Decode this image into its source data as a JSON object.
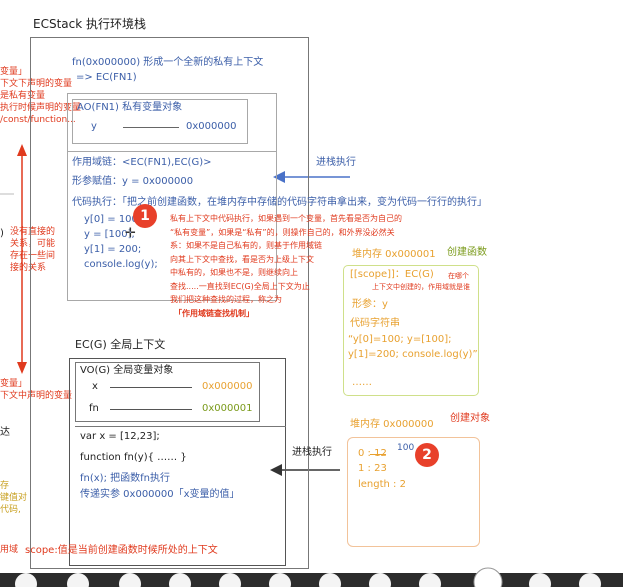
{
  "header": {
    "title": "ECStack   执行环境栈"
  },
  "left_notes": {
    "top": [
      "变量」",
      "下文下声明的变量",
      "是私有变量",
      "执行时候声明的变量",
      "/const/function..."
    ],
    "relation": [
      "没有直接的",
      "关系，可能",
      "存在一些间",
      "接的关系"
    ],
    "bottom": [
      "变量」",
      "下文中声明的变量"
    ],
    "frag_a": "达",
    "frag_b": [
      "存",
      "键值对",
      "代码,"
    ],
    "frag_c": "用域"
  },
  "fn_context": {
    "title": "fn(0x000000) 形成一个全新的私有上下文",
    "push": "=> EC(FN1)",
    "ao_title": "AO(FN1) 私有变量对象",
    "ao_var": "y",
    "ao_value": "0x000000",
    "scope_chain": "作用域链：<EC(FN1),EC(G)>",
    "param_assign": "形参赋值：y = 0x000000",
    "exec_label": "代码执行：「把之前创建函数，在堆内存中存储的代码字符串拿出来，变为代码一行行的执行」",
    "code": [
      "y[0] = 100;",
      "y = [100];",
      "y[1] = 200;",
      "console.log(y);"
    ]
  },
  "badge1": "1",
  "badge2": "2",
  "explanation": [
    "私有上下文中代码执行，如果遇到一个变量，首先看是否为自己的",
    "“私有变量”，如果是“私有”的，则操作自己的，和外界没必然关",
    "系：如果不是自己私有的，则基于作用域链",
    "向其上下文中查找，看是否为上级上下文",
    "中私有的，如果也不是，则继续向上",
    "查找.....一直找到EC(G)全局上下文为止",
    "我们把这种查找的过程，称之为"
  ],
  "explanation_highlight": "「作用域链查找机制」",
  "arrow1_label": "进栈执行",
  "heap_fn": {
    "title": "堆内存 0x000001",
    "label": "创建函数",
    "scope": "[[scope]]：EC(G)",
    "scope_note": [
      "在哪个",
      "上下文中创建的，作用域就是谁"
    ],
    "param": "形参：y",
    "code_title": "代码字符串",
    "code_lines": [
      "“y[0]=100; y=[100];",
      "y[1]=200; console.log(y)”"
    ],
    "ellipsis": "……"
  },
  "global": {
    "title": "EC(G) 全局上下文",
    "vo_title": "VO(G) 全局变量对象",
    "var_x": "x",
    "x_value": "0x000000",
    "var_fn": "fn",
    "fn_value": "0x000001",
    "code": [
      "var x = [12,23];",
      "function fn(y){ …… }",
      "fn(x);  把函数fn执行"
    ],
    "pass": "传递实参 0x000000「x变量的值」",
    "scope_note": "scope:值是当前创建函数时候所处的上下文"
  },
  "arrow2_label": "进栈执行",
  "heap_obj": {
    "title": "堆内存 0x000000",
    "label": "创建对象",
    "row0": "0 : 12",
    "row0_new": "100",
    "row1": "1 : 23",
    "length": "length : 2"
  },
  "colors": {
    "red": "#e03a1e",
    "blue": "#3b5ea8",
    "orange": "#e8a130",
    "green": "#7a9a1a",
    "badge": "#e8402a",
    "arrow": "#4a72c8"
  }
}
